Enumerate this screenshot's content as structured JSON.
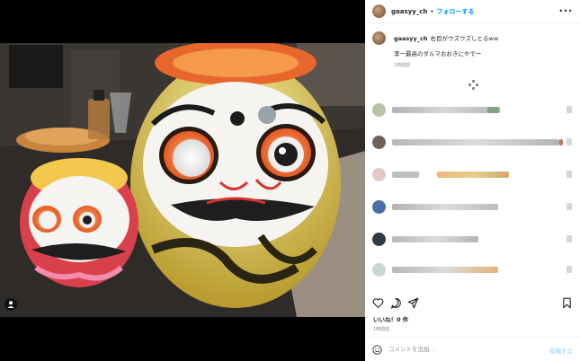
{
  "post": {
    "username": "gaasyy_ch",
    "separator": "•",
    "follow_label": "フォローする",
    "more_label": "•••"
  },
  "caption": {
    "username": "gaasyy_ch",
    "text_line1": "右目がウズウズしとるww",
    "text_line2": "李一最高のダルマおおきにやでー",
    "time": "1時間前"
  },
  "footer": {
    "likes": "いいね！0 件",
    "time": "1時間前",
    "comment_placeholder": "コメントを追加...",
    "post_label": "投稿する"
  },
  "icons": {
    "like": "heart-icon",
    "comment": "comment-icon",
    "share": "paper-plane-icon",
    "save": "bookmark-icon",
    "emoji": "emoji-icon",
    "tag": "user-tag-icon"
  },
  "colors": {
    "accent": "#0095f6",
    "post_button_disabled": "#b2dffc",
    "muted_text": "#8e8e8e"
  }
}
